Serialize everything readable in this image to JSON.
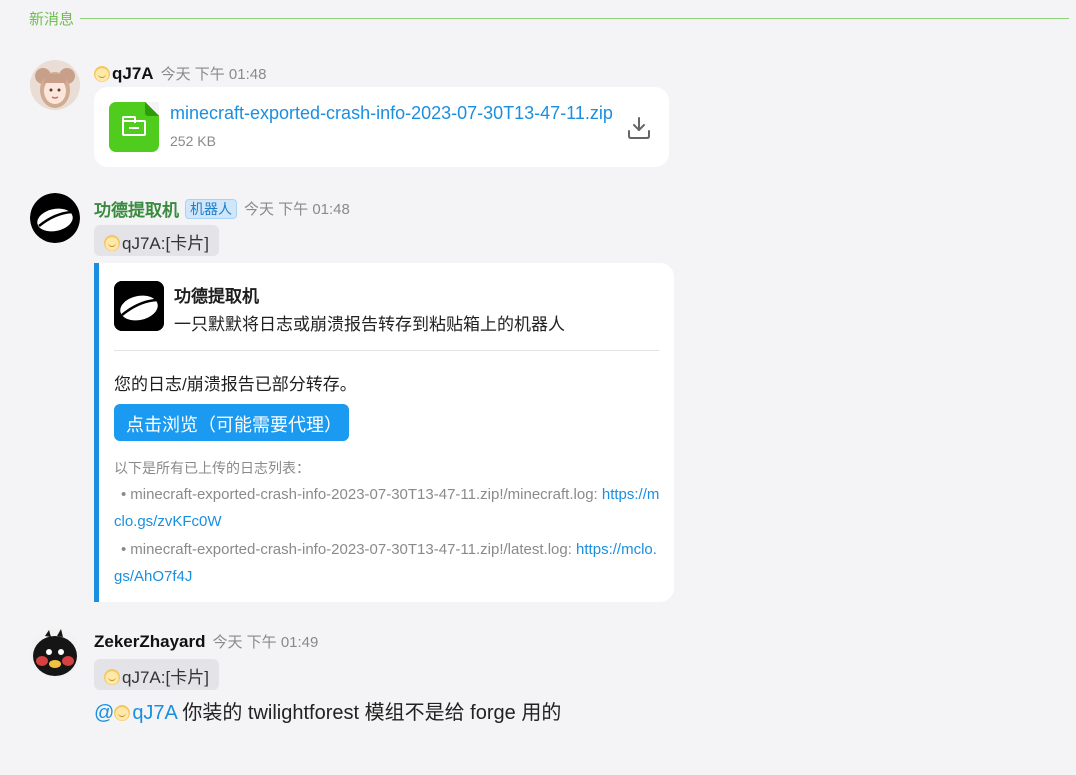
{
  "divider": {
    "label": "新消息"
  },
  "messages": [
    {
      "sender": "qJ7A",
      "time": "今天 下午 01:48",
      "file": {
        "name": "minecraft-exported-crash-info-2023-07-30T13-47-11.zip",
        "size": "252 KB",
        "icon": "folder-icon",
        "download_icon": "download-icon"
      }
    },
    {
      "sender": "功德提取机",
      "badge": "机器人",
      "time": "今天 下午 01:48",
      "quote": "qJ7A:[卡片]",
      "card": {
        "title": "功德提取机",
        "description": "一只默默将日志或崩溃报告转存到粘贴箱上的机器人",
        "status": "您的日志/崩溃报告已部分转存。",
        "button": "点击浏览（可能需要代理）",
        "list_title": "以下是所有已上传的日志列表：",
        "logs": [
          {
            "text": "minecraft-exported-crash-info-2023-07-30T13-47-11.zip!/minecraft.log: ",
            "link": "https://mclo.gs/zvKFc0W"
          },
          {
            "text": "minecraft-exported-crash-info-2023-07-30T13-47-11.zip!/latest.log: ",
            "link": "https://mclo.gs/AhO7f4J"
          }
        ]
      }
    },
    {
      "sender": "ZekerZhayard",
      "time": "今天 下午 01:49",
      "quote": "qJ7A:[卡片]",
      "mention": "@",
      "mention_name": "qJ7A",
      "text": " 你装的 twilightforest 模组不是给 forge 用的"
    }
  ]
}
